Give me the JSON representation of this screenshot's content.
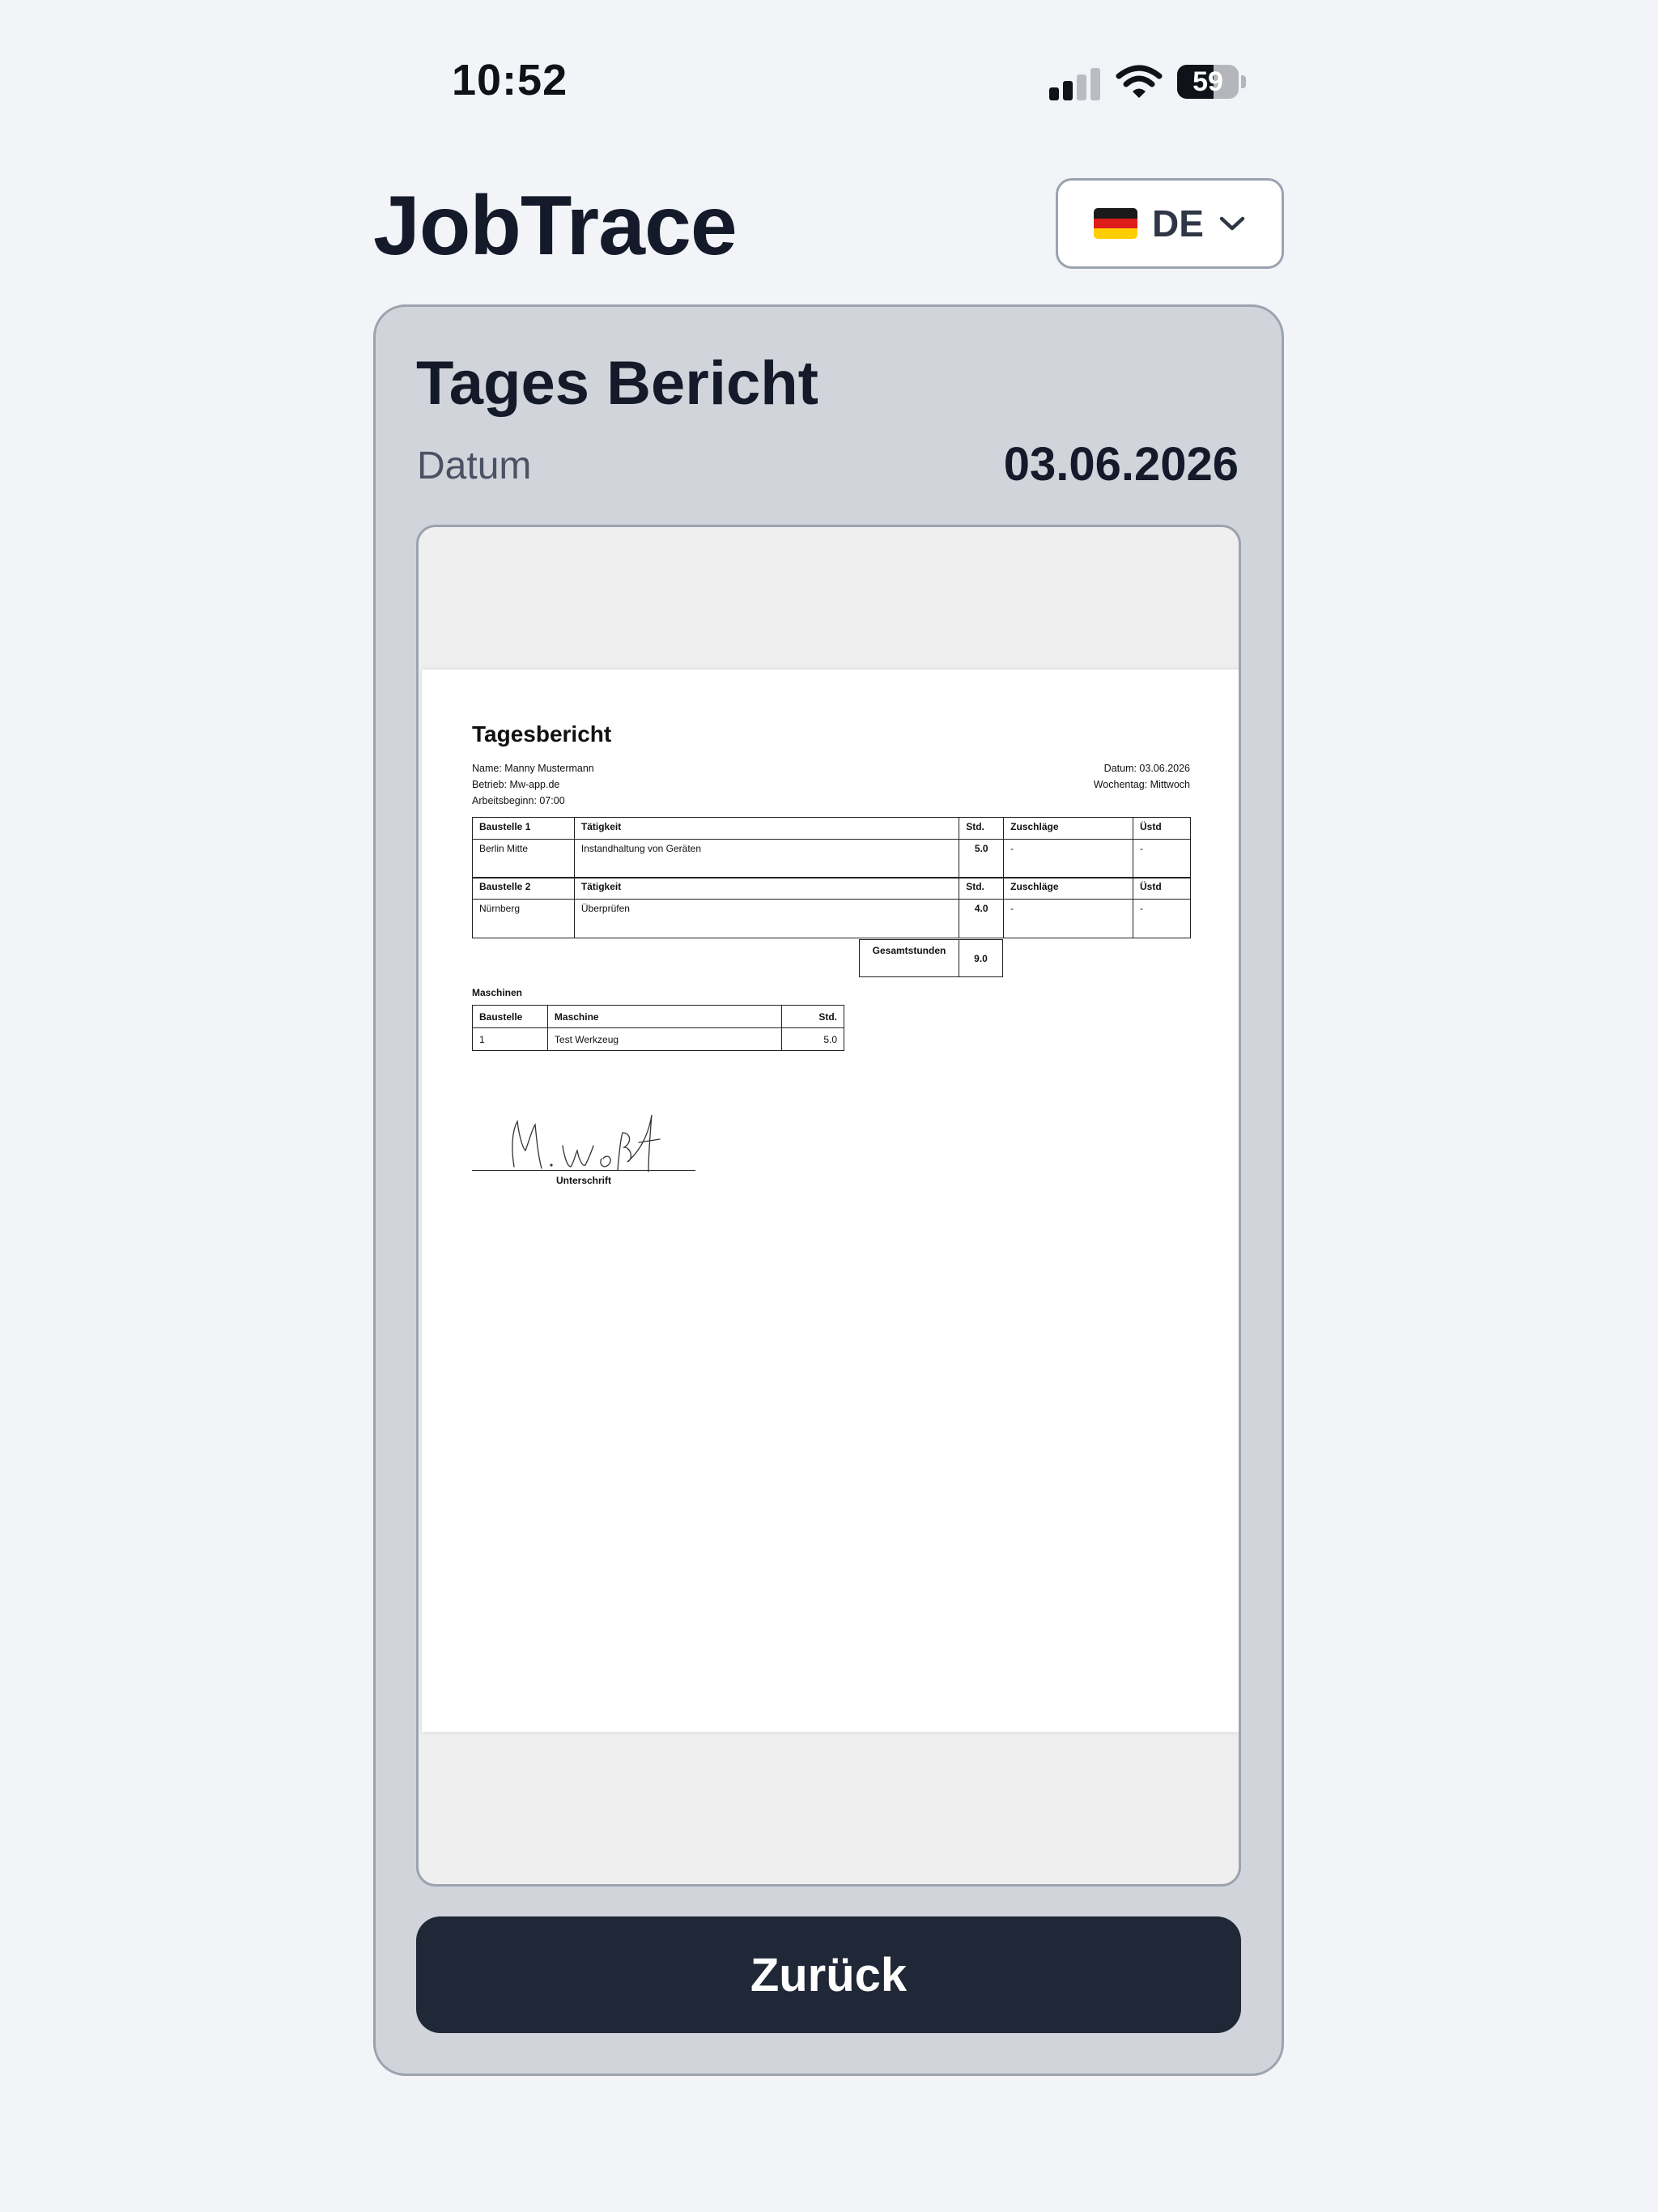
{
  "status_bar": {
    "time": "10:52",
    "battery": "59",
    "battery_level": 0.59,
    "signal_bars": 2,
    "signal_bars_total": 4
  },
  "header": {
    "app_title": "JobTrace",
    "language": {
      "code": "DE",
      "flag": "germany-flag-icon",
      "icon": "chevron-down-icon"
    }
  },
  "card": {
    "title": "Tages Bericht",
    "date_label": "Datum",
    "date_value": "03.06.2026"
  },
  "document": {
    "title": "Tagesbericht",
    "info_left": [
      "Name: Manny Mustermann",
      "Betrieb: Mw-app.de",
      "Arbeitsbeginn: 07:00"
    ],
    "info_right": [
      "Datum: 03.06.2026",
      "Wochentag: Mittwoch"
    ],
    "sites": [
      {
        "headers": [
          "Baustelle 1",
          "Tätigkeit",
          "Std.",
          "Zuschläge",
          "Üstd"
        ],
        "row": [
          "Berlin Mitte",
          "Instandhaltung von Geräten",
          "5.0",
          "-",
          "-"
        ]
      },
      {
        "headers": [
          "Baustelle 2",
          "Tätigkeit",
          "Std.",
          "Zuschläge",
          "Üstd"
        ],
        "row": [
          "Nürnberg",
          "Überprüfen",
          "4.0",
          "-",
          "-"
        ]
      }
    ],
    "total": {
      "label": "Gesamtstunden",
      "value": "9.0"
    },
    "machines": {
      "title": "Maschinen",
      "headers": [
        "Baustelle",
        "Maschine",
        "Std."
      ],
      "rows": [
        [
          "1",
          "Test Werkzeug",
          "5.0"
        ]
      ]
    },
    "signature_label": "Unterschrift"
  },
  "actions": {
    "back_label": "Zurück"
  },
  "colors": {
    "background": "#f2f4f8",
    "card": "#d1d5db",
    "button": "#202736",
    "title_text": "#141a2a"
  }
}
